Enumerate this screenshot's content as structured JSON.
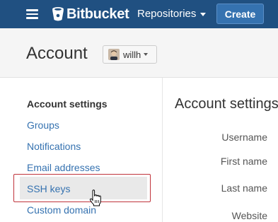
{
  "topbar": {
    "brand": "Bitbucket",
    "repositories_label": "Repositories",
    "create_label": "Create",
    "background": "#205081",
    "create_background": "#3572b0"
  },
  "header": {
    "title": "Account",
    "user": {
      "name": "willh"
    }
  },
  "sidebar": {
    "heading": "Account settings",
    "items": [
      {
        "label": "Groups"
      },
      {
        "label": "Notifications"
      },
      {
        "label": "Email addresses"
      },
      {
        "label": "SSH keys",
        "active": true,
        "highlighted": true
      },
      {
        "label": "Custom domain"
      }
    ],
    "link_color": "#3572b0",
    "highlight_color": "#c0333b"
  },
  "main": {
    "title": "Account settings",
    "fields": [
      {
        "label": "Username"
      },
      {
        "label": "First name"
      },
      {
        "label": "Last name"
      },
      {
        "label": "Website"
      }
    ]
  },
  "icons": [
    "hamburger-menu-icon",
    "bitbucket-logo-icon",
    "chevron-down-icon",
    "user-avatar",
    "hand-pointer-cursor-icon"
  ]
}
